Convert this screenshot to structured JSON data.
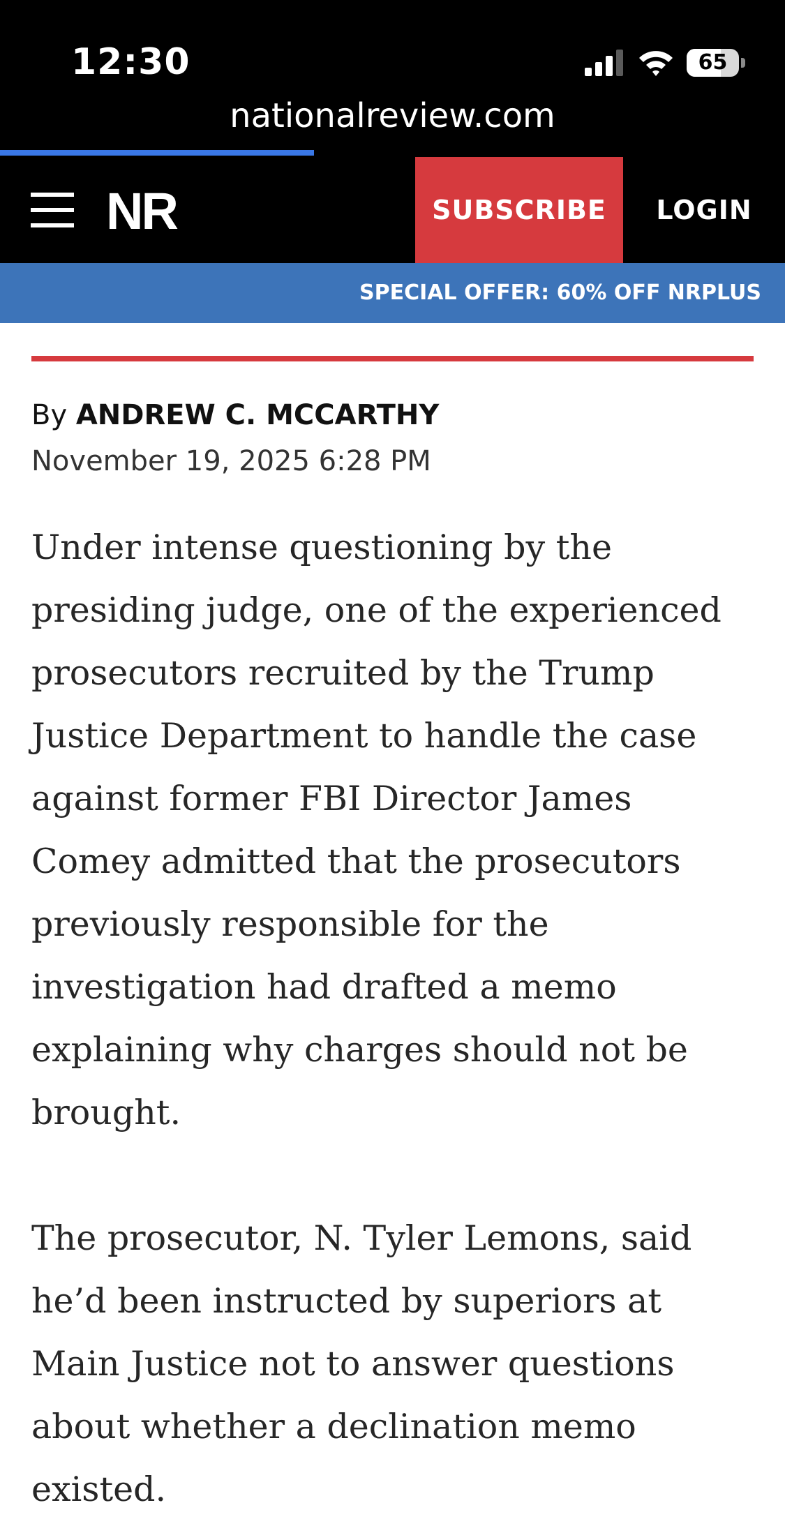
{
  "status_bar": {
    "time": "12:30",
    "battery_percent": 65,
    "battery_label": "65",
    "signal_icon": "cellular-signal-icon",
    "wifi_icon": "wifi-icon"
  },
  "browser": {
    "url": "nationalreview.com",
    "load_progress": 0.4
  },
  "header": {
    "logo": "NR",
    "subscribe_label": "SUBSCRIBE",
    "login_label": "LOGIN",
    "menu_icon": "hamburger-menu-icon"
  },
  "offer_banner": {
    "text": "SPECIAL OFFER: 60% OFF NRPLUS"
  },
  "article": {
    "byline_prefix": "By",
    "author": "ANDREW C. MCCARTHY",
    "date": "November 19, 2025 6:28 PM",
    "paragraphs": [
      "Under intense questioning by the presiding judge, one of the experienced prosecutors recruited by the Trump Justice Department to handle the case against former FBI Director James Comey admitted that the prosecutors previously responsible for the investigation had drafted a memo explaining why charges should not be brought.",
      "The prosecutor, N. Tyler Lemons, said he’d been instructed by superiors at Main Justice not to answer questions about whether a declination memo existed."
    ]
  },
  "colors": {
    "header_bg": "#000000",
    "subscribe_bg": "#d63a3e",
    "offer_bg": "#3d74b9",
    "rule": "#d63a3e",
    "progress": "#3a78e7"
  }
}
